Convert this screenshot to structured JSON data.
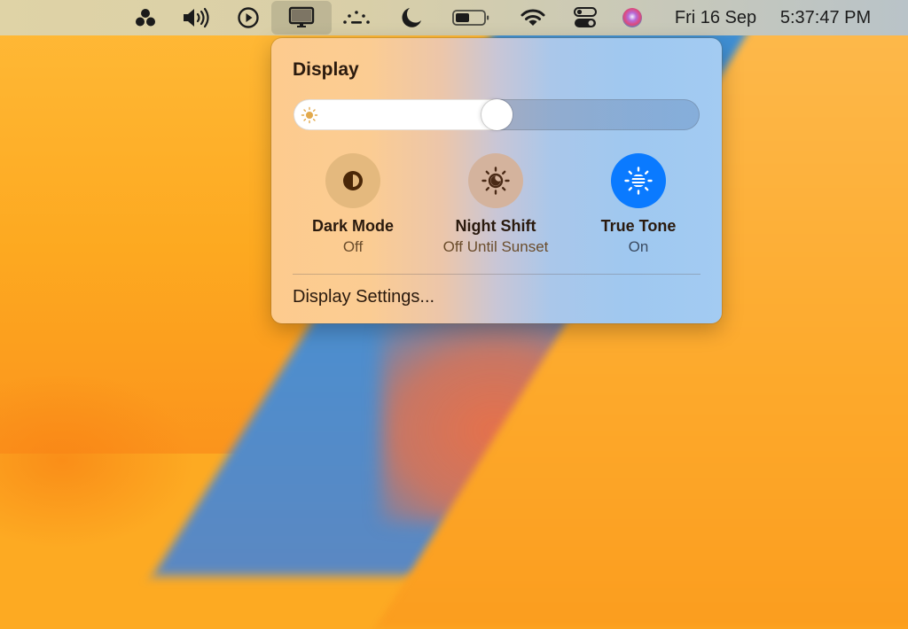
{
  "menubar": {
    "icons": [
      {
        "name": "app-menu-icon"
      },
      {
        "name": "volume-icon"
      },
      {
        "name": "now-playing-icon"
      },
      {
        "name": "display-icon",
        "active": true
      },
      {
        "name": "keyboard-brightness-icon"
      },
      {
        "name": "focus-moon-icon"
      },
      {
        "name": "battery-icon",
        "level": 0.5
      },
      {
        "name": "wifi-icon"
      },
      {
        "name": "control-center-icon"
      },
      {
        "name": "siri-icon"
      }
    ],
    "date": "Fri 16 Sep",
    "time": "5:37:47 PM"
  },
  "panel": {
    "title": "Display",
    "brightness": 0.5,
    "toggles": [
      {
        "label": "Dark Mode",
        "status": "Off",
        "icon": "dark-mode-icon",
        "on": false
      },
      {
        "label": "Night Shift",
        "status": "Off Until Sunset",
        "icon": "night-shift-icon",
        "on": false
      },
      {
        "label": "True Tone",
        "status": "On",
        "icon": "true-tone-icon",
        "on": true
      }
    ],
    "settings_label": "Display Settings..."
  },
  "colors": {
    "accent": "#0a7aff",
    "dark_mode_circle": "#e4b97e",
    "night_shift_circle": "#d4b39d"
  }
}
